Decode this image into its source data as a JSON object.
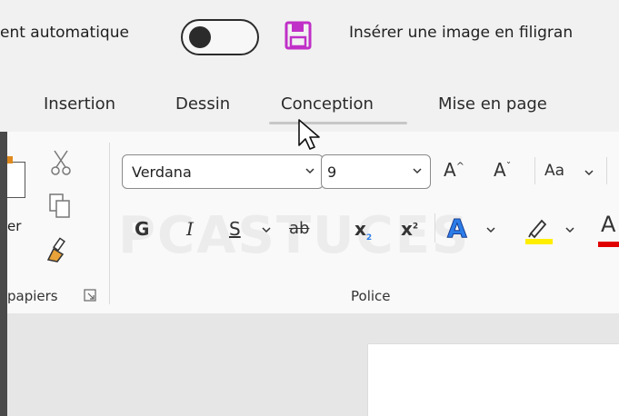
{
  "quick_access": {
    "autosave_label": "ent automatique",
    "filigrane_label": "Insérer une image en filigran"
  },
  "tabs": [
    "Insertion",
    "Dessin",
    "Conception",
    "Mise en page"
  ],
  "ribbon": {
    "clipboard": {
      "paste_label_fragment": "er",
      "group_label": "papiers"
    },
    "font": {
      "font_name": "Verdana",
      "font_size": "9",
      "bold": "G",
      "italic": "I",
      "underline": "S",
      "strikethrough": "ab",
      "subscript_base": "x",
      "subscript_mark": "2",
      "superscript_base": "x",
      "superscript_mark": "2",
      "text_effects": "A",
      "font_color": "A",
      "change_case": "Aa",
      "grow_font": "A",
      "shrink_font": "A",
      "group_label": "Police"
    }
  },
  "colors": {
    "accent_purple": "#c02fc7",
    "highlight_yellow": "#ffee00",
    "font_color_red": "#e00000",
    "text_effects_blue": "#2b7de9"
  },
  "watermark": "PCASTUCES"
}
